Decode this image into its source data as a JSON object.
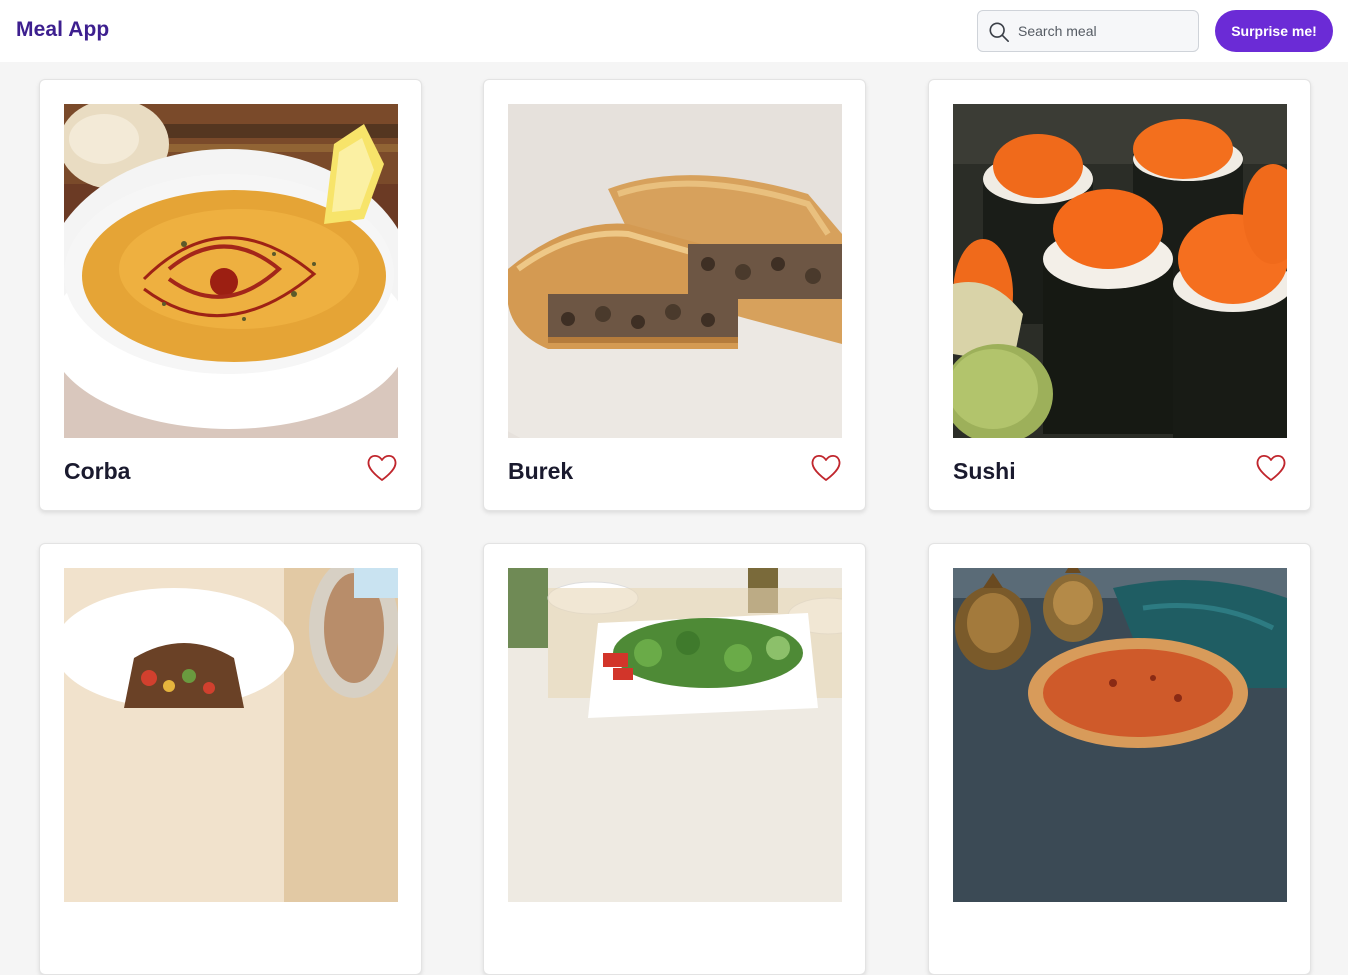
{
  "app": {
    "title": "Meal App"
  },
  "header": {
    "search": {
      "placeholder": "Search meal",
      "value": "",
      "icon": "search-icon"
    },
    "surprise_label": "Surprise me!"
  },
  "colors": {
    "brand": "#3d1f8f",
    "accent": "#6b2bd6",
    "favorite": "#c0262d"
  },
  "meals": [
    {
      "name": "Corba",
      "favorite": false,
      "icon": "heart-outline-icon"
    },
    {
      "name": "Burek",
      "favorite": false,
      "icon": "heart-outline-icon"
    },
    {
      "name": "Sushi",
      "favorite": false,
      "icon": "heart-outline-icon"
    },
    {
      "name": "",
      "favorite": false,
      "icon": "heart-outline-icon"
    },
    {
      "name": "",
      "favorite": false,
      "icon": "heart-outline-icon"
    },
    {
      "name": "",
      "favorite": false,
      "icon": "heart-outline-icon"
    }
  ]
}
